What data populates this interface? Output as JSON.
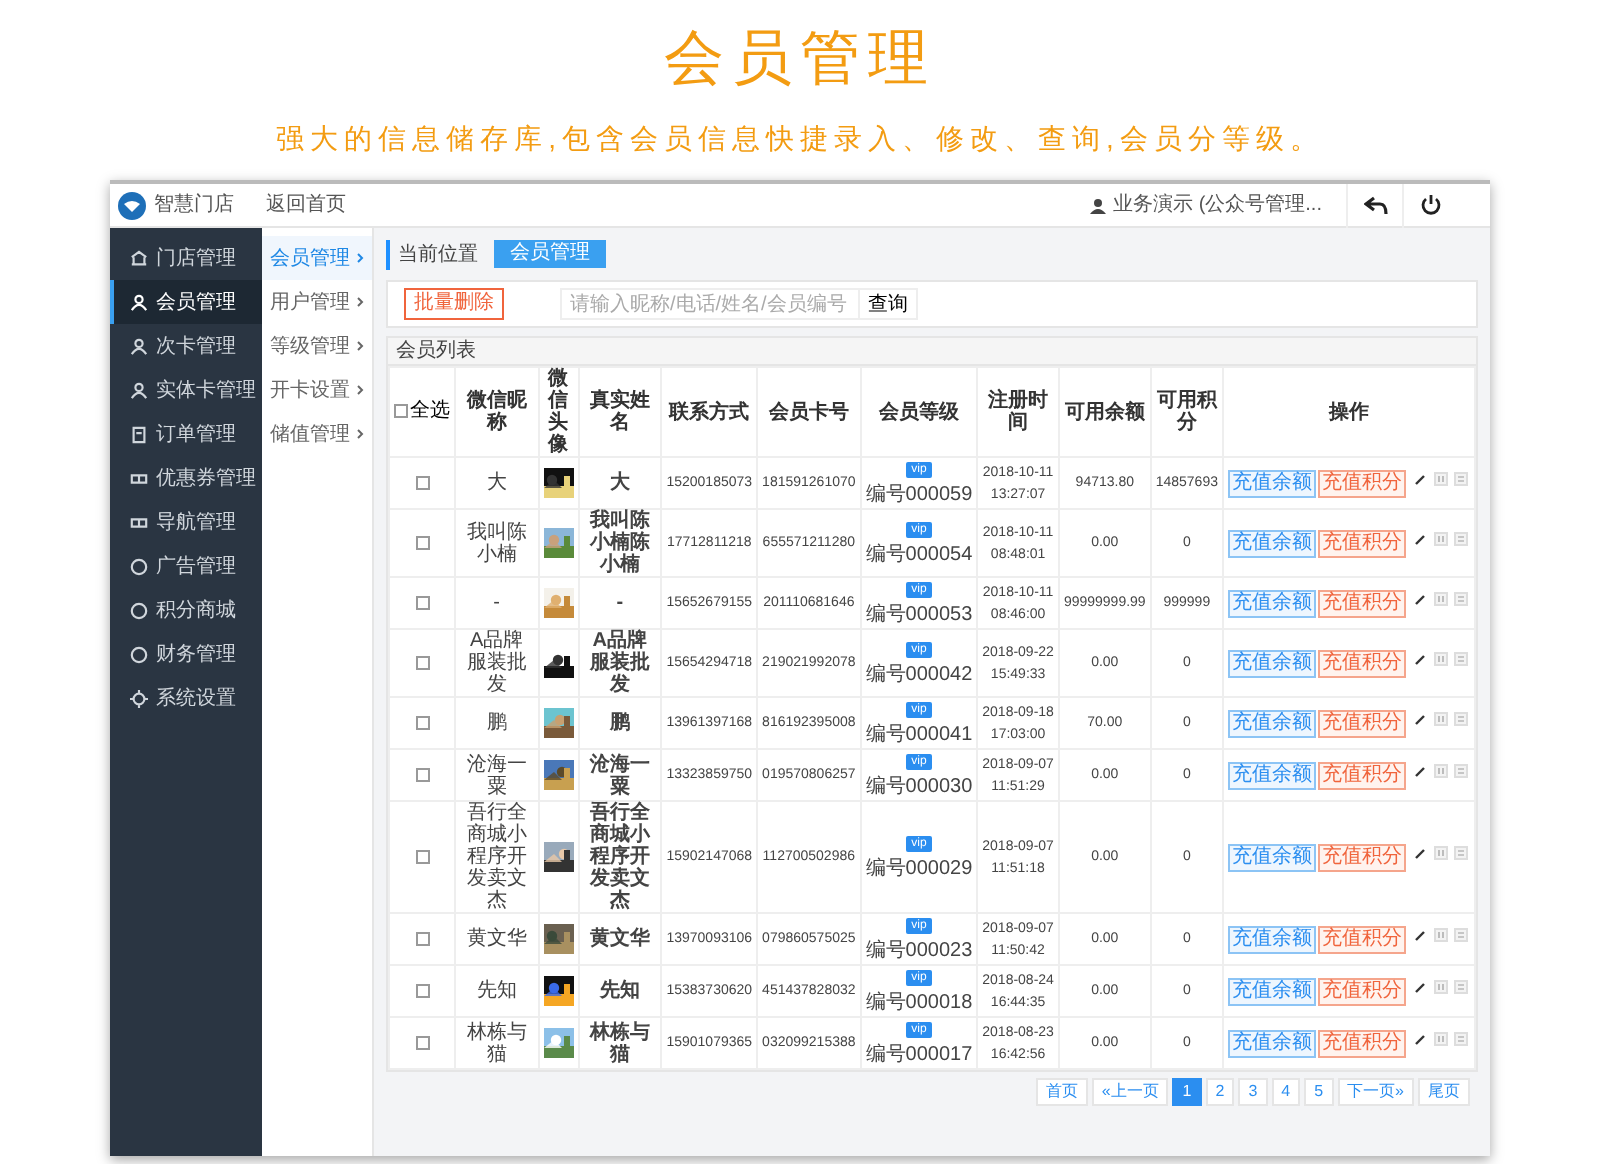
{
  "banner": {
    "title": "会员管理",
    "subtitle": "强大的信息储存库,包含会员信息快捷录入、修改、查询,会员分等级。"
  },
  "header": {
    "logo_text": "智慧门店",
    "home_link": "返回首页",
    "user": "业务演示 (公众号管理..."
  },
  "sidebar": {
    "items": [
      {
        "label": "门店管理",
        "selected": false
      },
      {
        "label": "会员管理",
        "selected": true
      },
      {
        "label": "次卡管理",
        "selected": false
      },
      {
        "label": "实体卡管理",
        "selected": false
      },
      {
        "label": "订单管理",
        "selected": false
      },
      {
        "label": "优惠券管理",
        "selected": false
      },
      {
        "label": "导航管理",
        "selected": false
      },
      {
        "label": "广告管理",
        "selected": false
      },
      {
        "label": "积分商城",
        "selected": false
      },
      {
        "label": "财务管理",
        "selected": false
      },
      {
        "label": "系统设置",
        "selected": false
      }
    ]
  },
  "subnav": {
    "items": [
      {
        "label": "会员管理",
        "selected": true
      },
      {
        "label": "用户管理",
        "selected": false
      },
      {
        "label": "等级管理",
        "selected": false
      },
      {
        "label": "开卡设置",
        "selected": false
      },
      {
        "label": "储值管理",
        "selected": false
      }
    ]
  },
  "breadcrumb": {
    "label": "当前位置",
    "current": "会员管理"
  },
  "toolbar": {
    "delete_button": "批量删除",
    "search": {
      "placeholder": "请输入昵称/电话/姓名/会员编号"
    },
    "search_button": "查询"
  },
  "table": {
    "title": "会员列表",
    "select_all": {
      "label": "全选",
      "checked": false
    },
    "columns": [
      "微信昵称",
      "微信头像",
      "真实姓名",
      "联系方式",
      "会员卡号",
      "会员等级",
      "注册时间",
      "可用余额",
      "可用积分",
      "操作"
    ],
    "rows": [
      {
        "checked": false,
        "nickname": "大",
        "real_name": "大",
        "phone": "15200185073",
        "card_no": "181591261070",
        "level_badge": "vip",
        "level_no": "编号000059",
        "date": "2018-10-11",
        "time": "13:27:07",
        "balance": "94713.80",
        "points": "14857693",
        "actions": [
          "充值余额",
          "充值积分"
        ]
      },
      {
        "checked": false,
        "nickname": "我叫陈小楠",
        "real_name": "我叫陈小楠陈小楠",
        "phone": "17712811218",
        "card_no": "655571211280",
        "level_badge": "vip",
        "level_no": "编号000054",
        "date": "2018-10-11",
        "time": "08:48:01",
        "balance": "0.00",
        "points": "0",
        "actions": [
          "充值余额",
          "充值积分"
        ]
      },
      {
        "checked": false,
        "nickname": "-",
        "real_name": "-",
        "phone": "15652679155",
        "card_no": "201110681646",
        "level_badge": "vip",
        "level_no": "编号000053",
        "date": "2018-10-11",
        "time": "08:46:00",
        "balance": "99999999.99",
        "points": "999999",
        "actions": [
          "充值余额",
          "充值积分"
        ]
      },
      {
        "checked": false,
        "nickname": "A品牌服装批发",
        "real_name": "A品牌服装批发",
        "phone": "15654294718",
        "card_no": "219021992078",
        "level_badge": "vip",
        "level_no": "编号000042",
        "date": "2018-09-22",
        "time": "15:49:33",
        "balance": "0.00",
        "points": "0",
        "actions": [
          "充值余额",
          "充值积分"
        ]
      },
      {
        "checked": false,
        "nickname": "鹏",
        "real_name": "鹏",
        "phone": "13961397168",
        "card_no": "816192395008",
        "level_badge": "vip",
        "level_no": "编号000041",
        "date": "2018-09-18",
        "time": "17:03:00",
        "balance": "70.00",
        "points": "0",
        "actions": [
          "充值余额",
          "充值积分"
        ]
      },
      {
        "checked": false,
        "nickname": "沧海一粟",
        "real_name": "沧海一粟",
        "phone": "13323859750",
        "card_no": "019570806257",
        "level_badge": "vip",
        "level_no": "编号000030",
        "date": "2018-09-07",
        "time": "11:51:29",
        "balance": "0.00",
        "points": "0",
        "actions": [
          "充值余额",
          "充值积分"
        ]
      },
      {
        "checked": false,
        "nickname": "吾行全商城小程序开发卖文杰",
        "real_name": "吾行全商城小程序开发卖文杰",
        "phone": "15902147068",
        "card_no": "112700502986",
        "level_badge": "vip",
        "level_no": "编号000029",
        "date": "2018-09-07",
        "time": "11:51:18",
        "balance": "0.00",
        "points": "0",
        "actions": [
          "充值余额",
          "充值积分"
        ]
      },
      {
        "checked": false,
        "nickname": "黄文华",
        "real_name": "黄文华",
        "phone": "13970093106",
        "card_no": "079860575025",
        "level_badge": "vip",
        "level_no": "编号000023",
        "date": "2018-09-07",
        "time": "11:50:42",
        "balance": "0.00",
        "points": "0",
        "actions": [
          "充值余额",
          "充值积分"
        ]
      },
      {
        "checked": false,
        "nickname": "先知",
        "real_name": "先知",
        "phone": "15383730620",
        "card_no": "451437828032",
        "level_badge": "vip",
        "level_no": "编号000018",
        "date": "2018-08-24",
        "time": "16:44:35",
        "balance": "0.00",
        "points": "0",
        "actions": [
          "充值余额",
          "充值积分"
        ]
      },
      {
        "checked": false,
        "nickname": "林栋与猫",
        "real_name": "林栋与猫",
        "phone": "15901079365",
        "card_no": "032099215388",
        "level_badge": "vip",
        "level_no": "编号000017",
        "date": "2018-08-23",
        "time": "16:42:56",
        "balance": "0.00",
        "points": "0",
        "actions": [
          "充值余额",
          "充值积分"
        ]
      }
    ]
  },
  "pagination": {
    "first": "首页",
    "prev": "«上一页",
    "pages": [
      {
        "label": "1",
        "selected": true
      },
      {
        "label": "2",
        "selected": false
      },
      {
        "label": "3",
        "selected": false
      },
      {
        "label": "4",
        "selected": false
      },
      {
        "label": "5",
        "selected": false
      }
    ],
    "next": "下一页»",
    "last": "尾页"
  }
}
